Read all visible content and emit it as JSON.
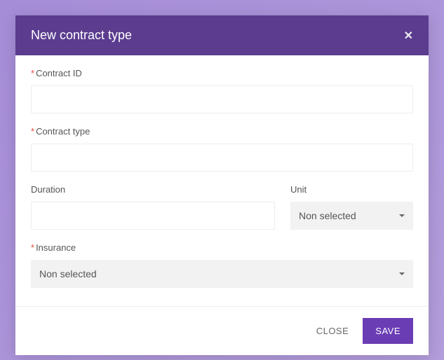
{
  "modal": {
    "title": "New contract type"
  },
  "fields": {
    "contract_id": {
      "label": "Contract ID",
      "value": ""
    },
    "contract_type": {
      "label": "Contract type",
      "value": ""
    },
    "duration": {
      "label": "Duration",
      "value": ""
    },
    "unit": {
      "label": "Unit",
      "selected": "Non selected"
    },
    "insurance": {
      "label": "Insurance",
      "selected": "Non selected"
    }
  },
  "footer": {
    "close_label": "CLOSE",
    "save_label": "SAVE"
  }
}
